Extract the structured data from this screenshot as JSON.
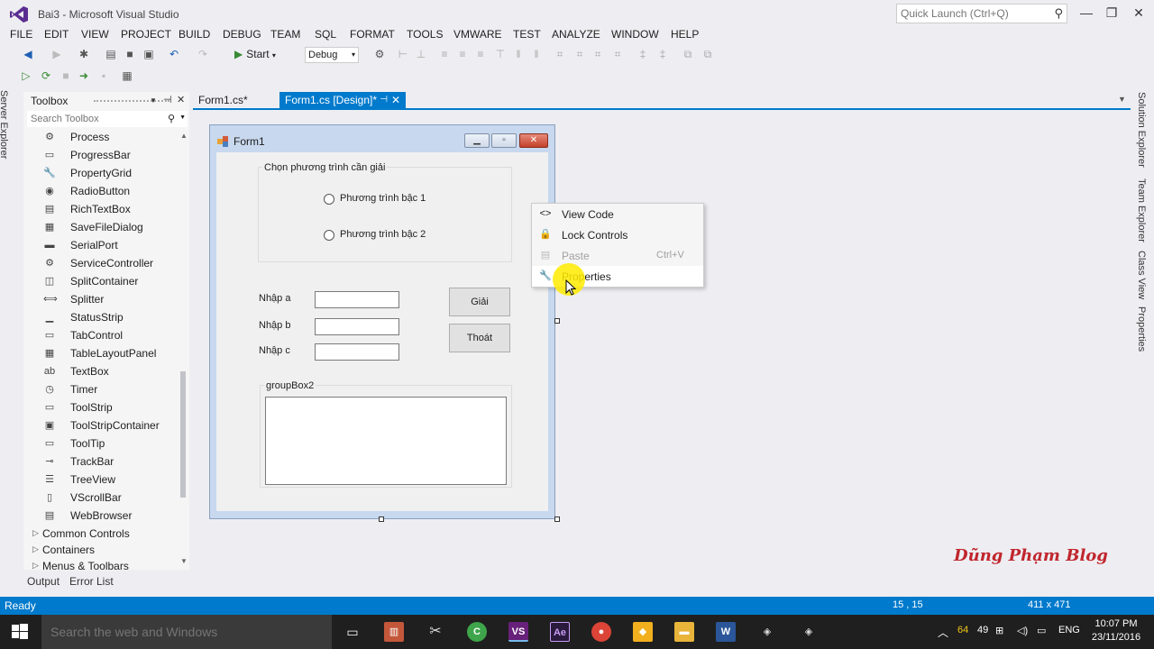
{
  "window": {
    "title": "Bai3 - Microsoft Visual Studio",
    "quick_launch_placeholder": "Quick Launch (Ctrl+Q)"
  },
  "menu": [
    "FILE",
    "EDIT",
    "VIEW",
    "PROJECT",
    "BUILD",
    "DEBUG",
    "TEAM",
    "SQL",
    "FORMAT",
    "TOOLS",
    "VMWARE",
    "TEST",
    "ANALYZE",
    "WINDOW",
    "HELP"
  ],
  "toolbar": {
    "start_label": "Start",
    "configuration": "Debug"
  },
  "left_side_tab": "Server Explorer",
  "toolbox": {
    "title": "Toolbox",
    "search_placeholder": "Search Toolbox",
    "items": [
      {
        "label": "Process",
        "icon": "process-icon"
      },
      {
        "label": "ProgressBar",
        "icon": "progressbar-icon"
      },
      {
        "label": "PropertyGrid",
        "icon": "propertygrid-icon"
      },
      {
        "label": "RadioButton",
        "icon": "radiobutton-icon"
      },
      {
        "label": "RichTextBox",
        "icon": "richtextbox-icon"
      },
      {
        "label": "SaveFileDialog",
        "icon": "savefiledialog-icon"
      },
      {
        "label": "SerialPort",
        "icon": "serialport-icon"
      },
      {
        "label": "ServiceController",
        "icon": "servicecontroller-icon"
      },
      {
        "label": "SplitContainer",
        "icon": "splitcontainer-icon"
      },
      {
        "label": "Splitter",
        "icon": "splitter-icon"
      },
      {
        "label": "StatusStrip",
        "icon": "statusstrip-icon"
      },
      {
        "label": "TabControl",
        "icon": "tabcontrol-icon"
      },
      {
        "label": "TableLayoutPanel",
        "icon": "tablelayoutpanel-icon"
      },
      {
        "label": "TextBox",
        "icon": "textbox-icon"
      },
      {
        "label": "Timer",
        "icon": "timer-icon"
      },
      {
        "label": "ToolStrip",
        "icon": "toolstrip-icon"
      },
      {
        "label": "ToolStripContainer",
        "icon": "toolstripcontainer-icon"
      },
      {
        "label": "ToolTip",
        "icon": "tooltip-icon"
      },
      {
        "label": "TrackBar",
        "icon": "trackbar-icon"
      },
      {
        "label": "TreeView",
        "icon": "treeview-icon"
      },
      {
        "label": "VScrollBar",
        "icon": "vscrollbar-icon"
      },
      {
        "label": "WebBrowser",
        "icon": "webbrowser-icon"
      }
    ],
    "categories": [
      "Common Controls",
      "Containers",
      "Menus & Toolbars"
    ]
  },
  "bottom_tabs": [
    "Output",
    "Error List"
  ],
  "doc_tabs": [
    {
      "label": "Form1.cs*",
      "active": false
    },
    {
      "label": "Form1.cs [Design]*",
      "active": true
    }
  ],
  "form": {
    "title": "Form1",
    "group1_label": "Chọn phương trình cần giải",
    "radio1": "Phương trình bậc 1",
    "radio2": "Phương trình bậc 2",
    "label_a": "Nhập a",
    "label_b": "Nhập b",
    "label_c": "Nhập c",
    "button_solve": "Giải",
    "button_exit": "Thoát",
    "group2_label": "groupBox2"
  },
  "context_menu": [
    {
      "label": "View Code",
      "icon": "code-icon",
      "shortcut": "",
      "enabled": true
    },
    {
      "label": "Lock Controls",
      "icon": "lock-icon",
      "shortcut": "",
      "enabled": true
    },
    {
      "label": "Paste",
      "icon": "paste-icon",
      "shortcut": "Ctrl+V",
      "enabled": false
    },
    {
      "label": "Properties",
      "icon": "wrench-icon",
      "shortcut": "",
      "enabled": true
    }
  ],
  "watermark": "Dũng Phạm Blog",
  "right_side_tabs": [
    "Solution Explorer",
    "Team Explorer",
    "Class View",
    "Properties"
  ],
  "status": {
    "text": "Ready",
    "position": "15 , 15",
    "size": "411 x 471"
  },
  "taskbar": {
    "search_placeholder": "Search the web and Windows",
    "tray_numbers": [
      "64",
      "49"
    ],
    "language": "ENG",
    "time": "10:07 PM",
    "date": "23/11/2016"
  },
  "colors": {
    "accent": "#007acc",
    "taskbar": "#1f1f1f",
    "watermark": "#c0262d"
  }
}
